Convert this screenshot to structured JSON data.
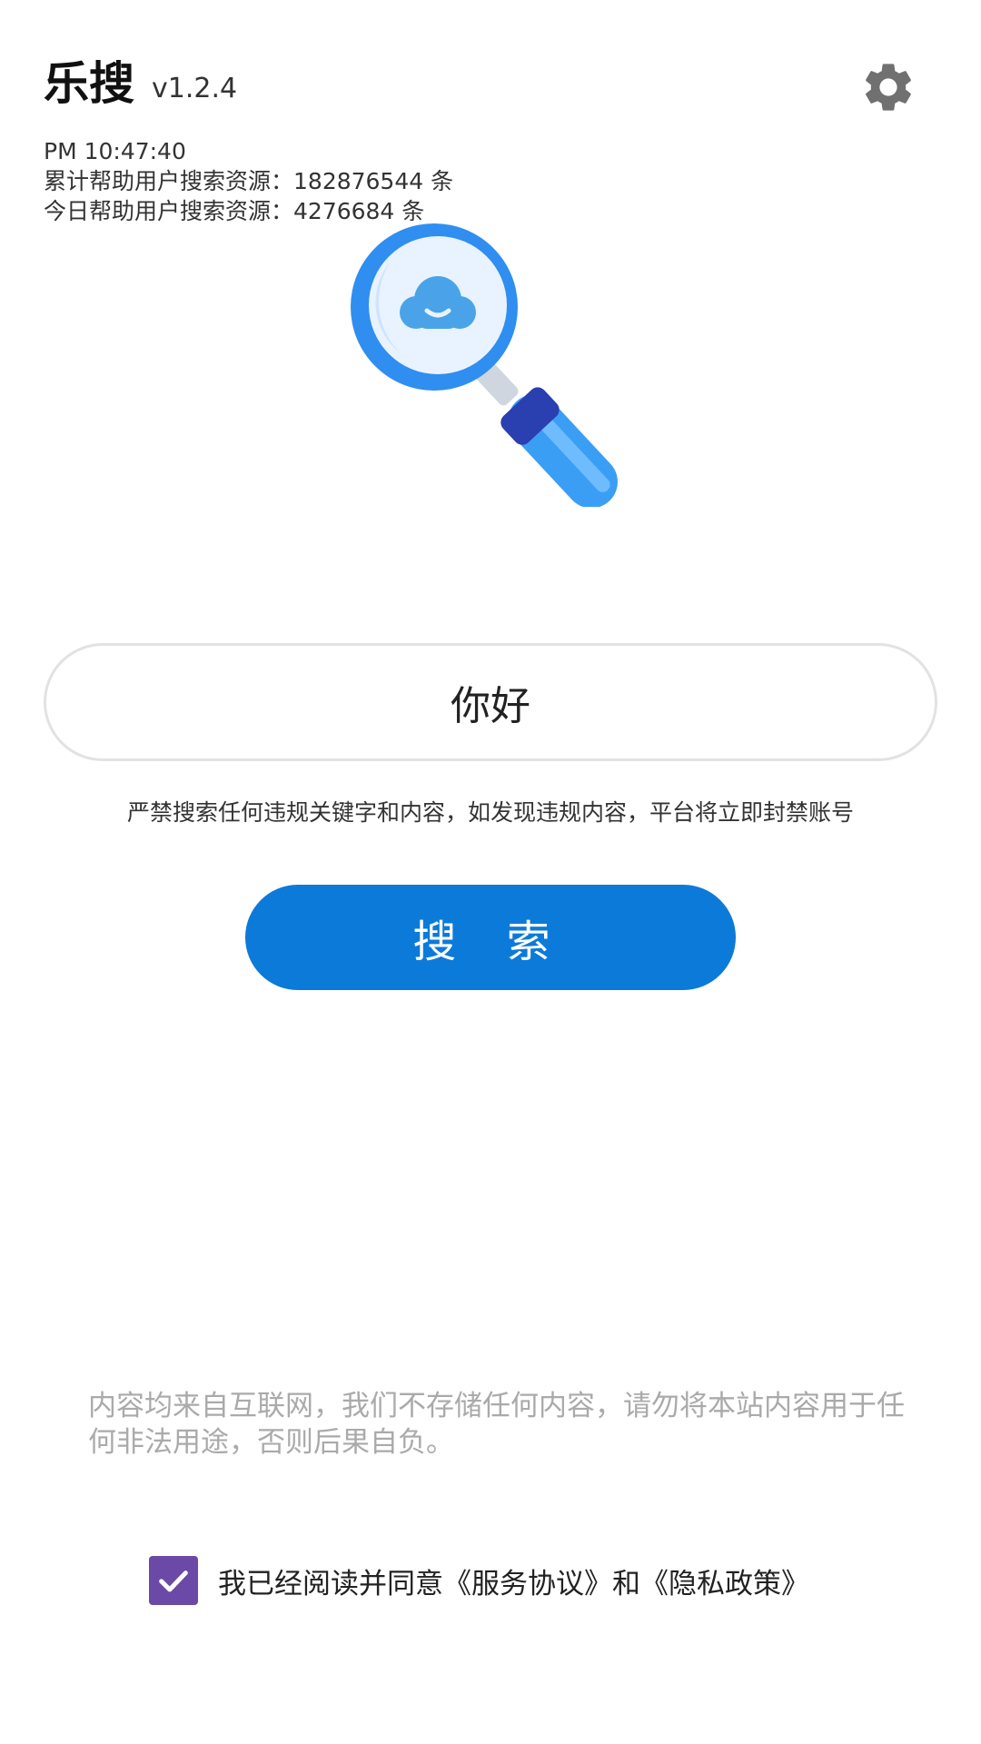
{
  "header": {
    "app_name": "乐搜",
    "version": "v1.2.4",
    "settings_icon": "gear-icon"
  },
  "stats": {
    "time": "PM 10:47:40",
    "total_line": "累计帮助用户搜索资源：182876544 条",
    "today_line": "今日帮助用户搜索资源：4276684 条"
  },
  "hero": {
    "icon": "magnifier-cloud-icon"
  },
  "search": {
    "value": "你好",
    "warning": "严禁搜索任何违规关键字和内容，如发现违规内容，平台将立即封禁账号",
    "button_label": "搜 索"
  },
  "footer": {
    "disclaimer": "内容均来自互联网，我们不存储任何内容，请勿将本站内容用于任何非法用途，否则后果自负。",
    "agreement_checked": true,
    "agreement_text": "我已经阅读并同意《服务协议》和《隐私政策》"
  },
  "colors": {
    "accent": "#0c7ad9",
    "checkbox": "#6a4aa6",
    "disclaimer_text": "#aaaaaa",
    "icon_gray": "#707070"
  }
}
